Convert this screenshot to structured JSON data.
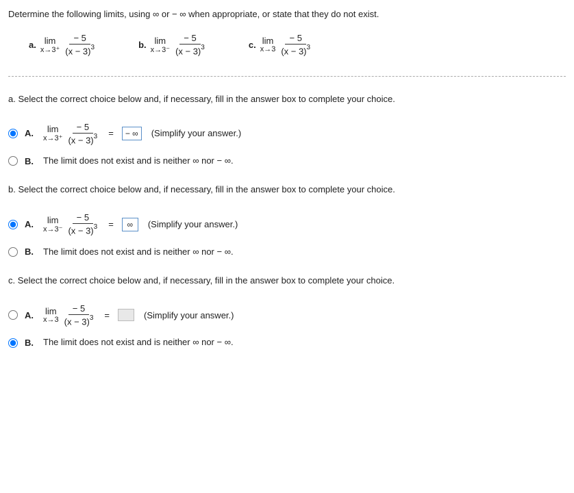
{
  "instructions": "Determine the following limits, using ∞ or − ∞ when appropriate, or state that they do not exist.",
  "limits_header": {
    "a": {
      "label": "a.",
      "lim": "lim",
      "sub": "x→3⁺",
      "num": "− 5",
      "den": "(x − 3)³"
    },
    "b": {
      "label": "b.",
      "lim": "lim",
      "sub": "x→3⁻",
      "num": "− 5",
      "den": "(x − 3)³"
    },
    "c": {
      "label": "c.",
      "lim": "lim",
      "sub": "x→3",
      "num": "− 5",
      "den": "(x − 3)³"
    }
  },
  "parts": {
    "a": {
      "prompt": "a. Select the correct choice below and, if necessary, fill in the answer box to complete your choice.",
      "choice_a": {
        "label": "A.",
        "lim": "lim",
        "sub": "x→3⁺",
        "num": "− 5",
        "den": "(x − 3)³",
        "eq": "=",
        "answer": "− ∞",
        "hint": "(Simplify your answer.)",
        "selected": true
      },
      "choice_b": {
        "label": "B.",
        "text": "The limit does not exist and is neither ∞ nor − ∞.",
        "selected": false
      }
    },
    "b": {
      "prompt": "b. Select the correct choice below and, if necessary, fill in the answer box to complete your choice.",
      "choice_a": {
        "label": "A.",
        "lim": "lim",
        "sub": "x→3⁻",
        "num": "− 5",
        "den": "(x − 3)³",
        "eq": "=",
        "answer": "∞",
        "hint": "(Simplify your answer.)",
        "selected": true
      },
      "choice_b": {
        "label": "B.",
        "text": "The limit does not exist and is neither ∞ nor − ∞.",
        "selected": false
      }
    },
    "c": {
      "prompt": "c. Select the correct choice below and, if necessary, fill in the answer box to complete your choice.",
      "choice_a": {
        "label": "A.",
        "lim": "lim",
        "sub": "x→3",
        "num": "− 5",
        "den": "(x − 3)³",
        "eq": "=",
        "answer": "",
        "hint": "(Simplify your answer.)",
        "selected": false
      },
      "choice_b": {
        "label": "B.",
        "text": "The limit does not exist and is neither ∞ nor − ∞.",
        "selected": true
      }
    }
  }
}
